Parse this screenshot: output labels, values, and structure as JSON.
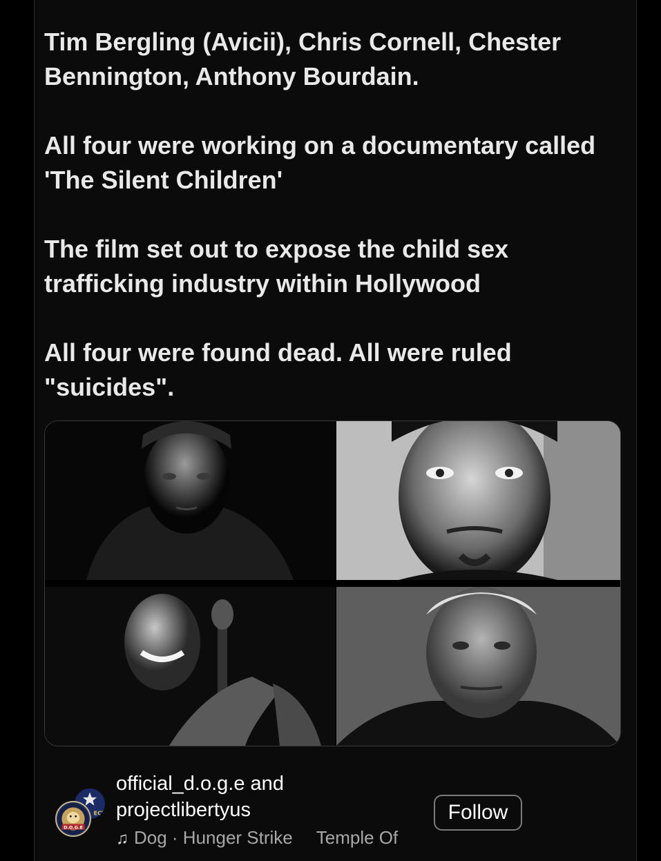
{
  "post": {
    "paragraphs": [
      "Tim Bergling (Avicii), Chris Cornell, Chester Bennington, Anthony Bourdain.",
      "All four were working on a documentary called 'The Silent Children'",
      "The film set out to expose the child sex trafficking industry within Hollywood",
      "All four were found dead. All were ruled \"suicides\"."
    ]
  },
  "images": [
    {
      "name": "photo-top-left"
    },
    {
      "name": "photo-top-right"
    },
    {
      "name": "photo-bottom-left"
    },
    {
      "name": "photo-bottom-right"
    }
  ],
  "footer": {
    "author_primary": "official_d.o.g.e",
    "joiner": " and",
    "author_secondary": "projectlibertyus",
    "audio_icon": "music-note-icon",
    "audio_text": "Dog · Hunger Strike",
    "audio_text_next": "Temple Of",
    "follow_label": "Follow",
    "avatar_primary_label": "D.O.G.E",
    "avatar_secondary_label": "ECT TY"
  },
  "colors": {
    "background": "#000000",
    "card": "#0b0b0b",
    "text": "#e9e9e9",
    "secondary_text": "#a8a8a8",
    "button_border": "#7a7a7a"
  }
}
